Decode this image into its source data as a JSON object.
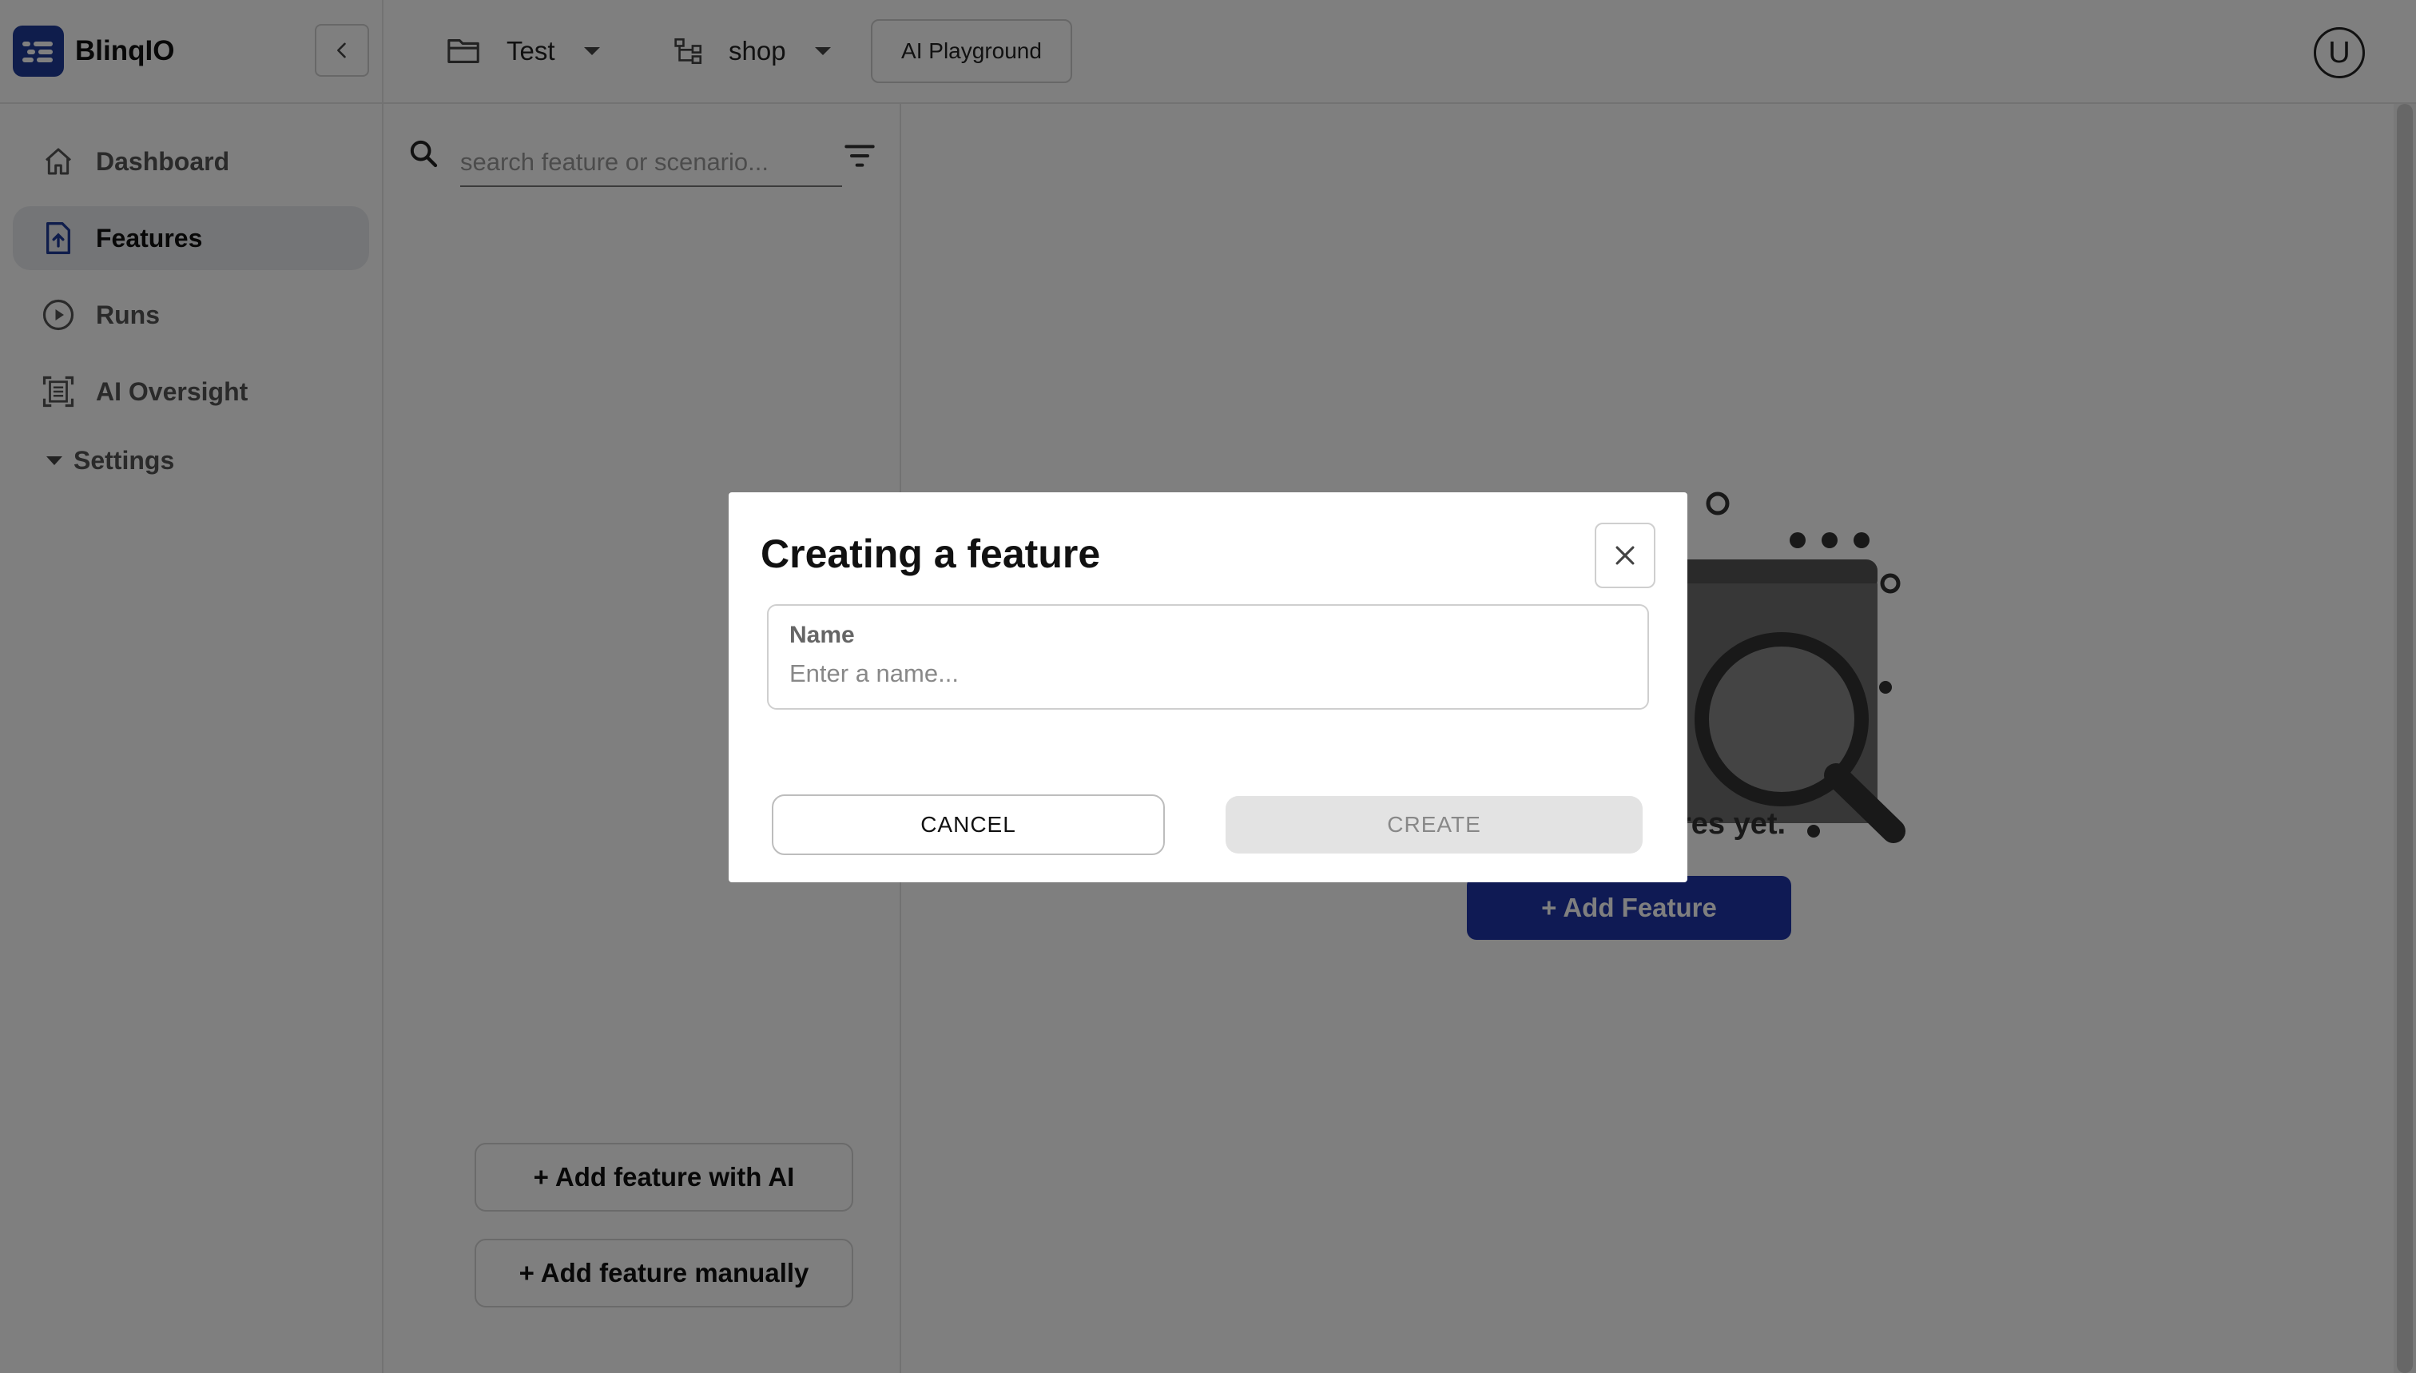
{
  "app": {
    "name": "BlinqIO",
    "brand_color": "#1f3a99",
    "accent_color": "#1e35a8"
  },
  "topbar": {
    "project_label": "Test",
    "project_icon": "folder-icon",
    "branch_label": "shop",
    "branch_icon": "hierarchy-icon",
    "playground_label": "AI Playground",
    "avatar_initial": "U"
  },
  "sidebar": {
    "items": [
      {
        "label": "Dashboard",
        "icon": "home-icon",
        "active": false
      },
      {
        "label": "Features",
        "icon": "file-upload-icon",
        "active": true
      },
      {
        "label": "Runs",
        "icon": "play-circle-icon",
        "active": false
      },
      {
        "label": "AI Oversight",
        "icon": "scan-document-icon",
        "active": false
      }
    ],
    "settings_label": "Settings"
  },
  "list_panel": {
    "search_placeholder": "search feature or scenario...",
    "add_with_ai_label": "+ Add feature with AI",
    "add_manually_label": "+ Add feature manually"
  },
  "main": {
    "empty_state_text": "No features yet.",
    "add_feature_label": "+ Add Feature"
  },
  "modal": {
    "title": "Creating a feature",
    "name_label": "Name",
    "name_placeholder": "Enter a name...",
    "name_value": "",
    "cancel_label": "CANCEL",
    "create_label": "CREATE",
    "create_disabled": true
  }
}
